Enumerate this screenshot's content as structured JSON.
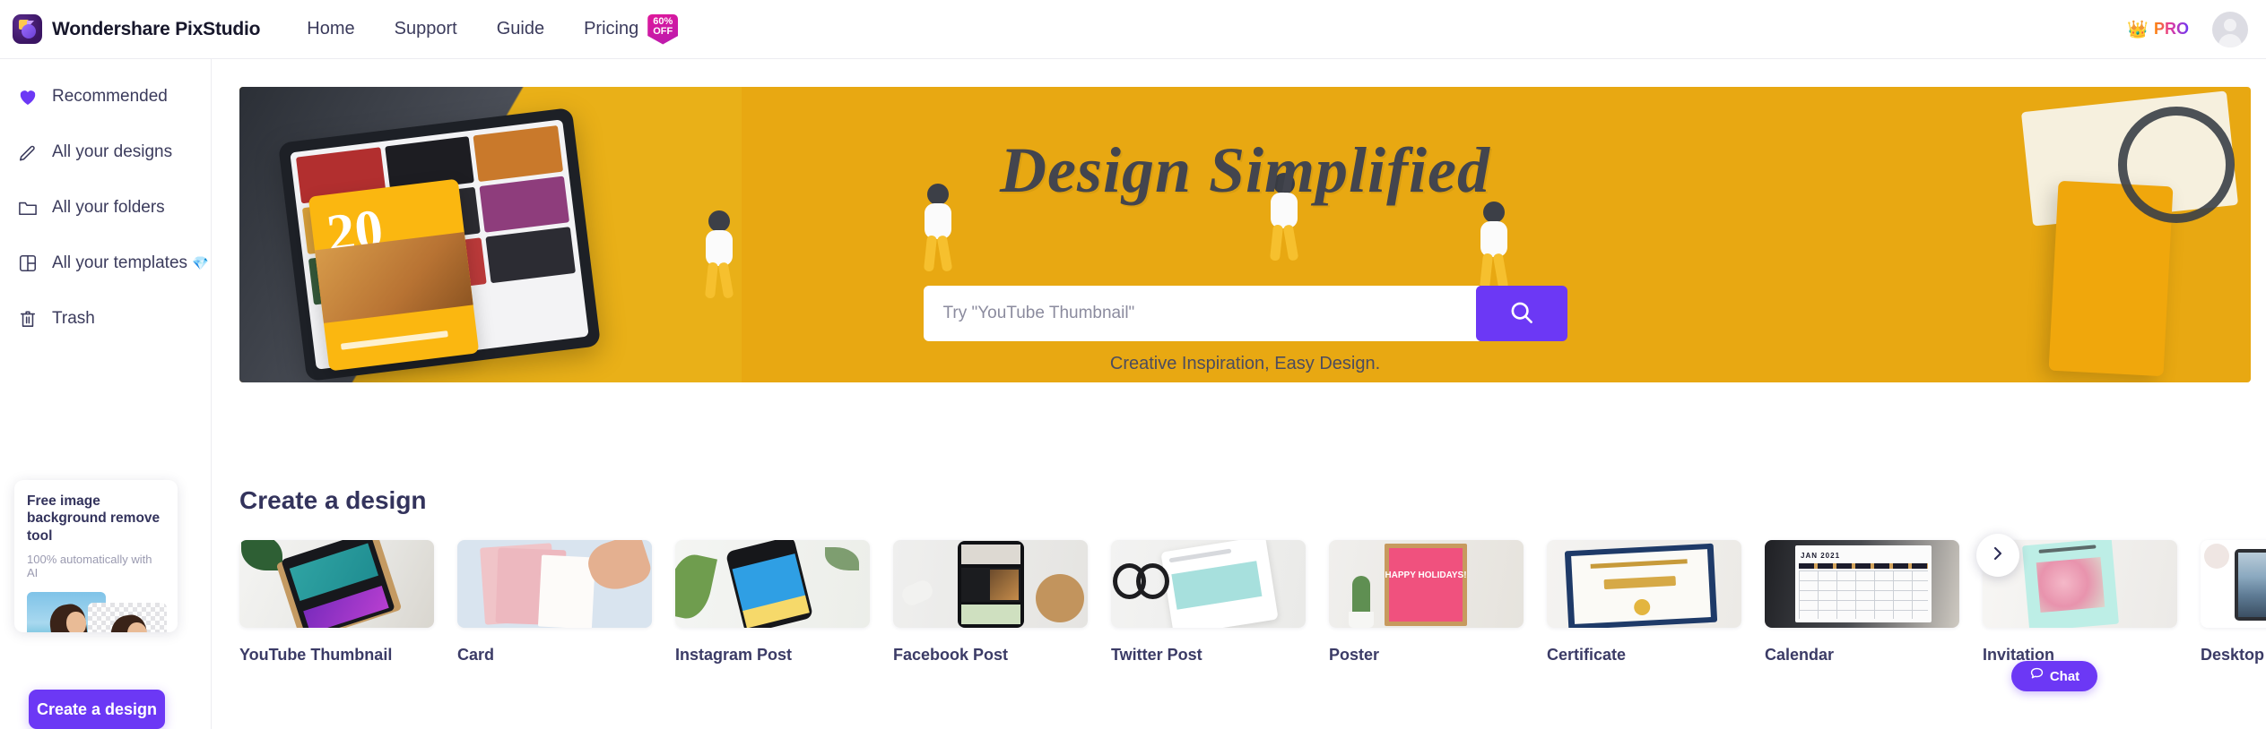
{
  "header": {
    "brand_name": "Wondershare PixStudio",
    "brand_logo_icon": "pixstudio-logo-icon",
    "nav": [
      {
        "label": "Home"
      },
      {
        "label": "Support"
      },
      {
        "label": "Guide"
      },
      {
        "label": "Pricing"
      }
    ],
    "offer_badge": {
      "line1": "60%",
      "line2": "OFF"
    },
    "pro": {
      "crown_icon": "crown-icon",
      "label": "PRO"
    },
    "avatar_icon": "user-avatar-icon"
  },
  "sidebar": {
    "items": [
      {
        "label": "Recommended",
        "icon": "heart-icon",
        "active": true
      },
      {
        "label": "All your designs",
        "icon": "pencil-icon",
        "active": false
      },
      {
        "label": "All your folders",
        "icon": "folder-icon",
        "active": false
      },
      {
        "label": "All your templates",
        "icon": "layout-icon",
        "badge": "💎",
        "active": false
      },
      {
        "label": "Trash",
        "icon": "trash-icon",
        "active": false
      }
    ],
    "promo": {
      "title": "Free image background remove tool",
      "subtitle": "100% automatically with AI"
    },
    "create_button": "Create a design"
  },
  "hero": {
    "title": "Design Simplified",
    "search_placeholder": "Try \"YouTube Thumbnail\"",
    "search_value": "",
    "search_icon": "search-icon",
    "tagline": "Creative Inspiration, Easy Design."
  },
  "main": {
    "section_title": "Create a design",
    "cards": [
      {
        "label": "YouTube Thumbnail"
      },
      {
        "label": "Card"
      },
      {
        "label": "Instagram Post"
      },
      {
        "label": "Facebook Post"
      },
      {
        "label": "Twitter Post"
      },
      {
        "label": "Poster"
      },
      {
        "label": "Certificate"
      },
      {
        "label": "Calendar"
      },
      {
        "label": "Invitation"
      },
      {
        "label": "Desktop Wallpaper"
      }
    ],
    "next_icon": "chevron-right-icon",
    "poster_text": "HAPPY HOLIDAYS!",
    "calendar_text": "JAN 2021"
  },
  "chat": {
    "label": "Chat",
    "icon": "chat-bubble-icon"
  },
  "colors": {
    "accent": "#6c38f5",
    "hero_bg": "#e8a812",
    "text_dark": "#33335c",
    "badge_pink": "#e0189a"
  }
}
